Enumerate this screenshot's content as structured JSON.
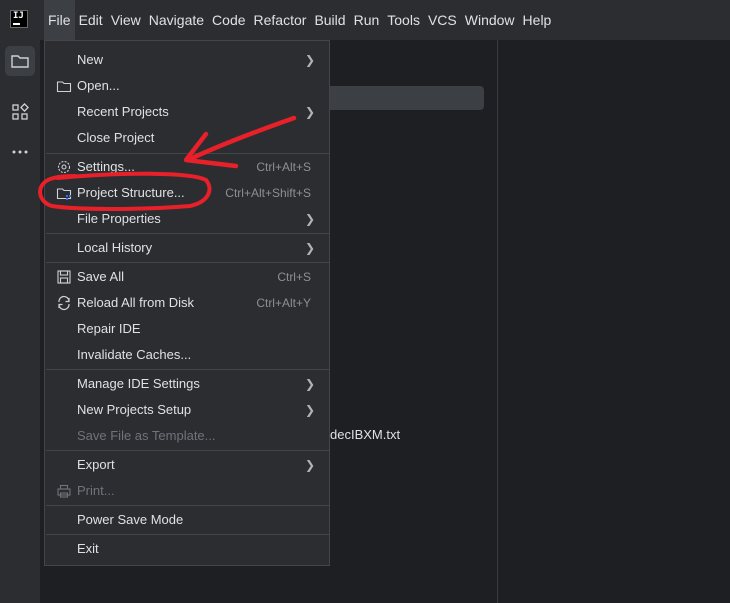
{
  "app": {
    "logo_text": "IJ"
  },
  "menubar": {
    "items": [
      {
        "label": "File"
      },
      {
        "label": "Edit"
      },
      {
        "label": "View"
      },
      {
        "label": "Navigate"
      },
      {
        "label": "Code"
      },
      {
        "label": "Refactor"
      },
      {
        "label": "Build"
      },
      {
        "label": "Run"
      },
      {
        "label": "Tools"
      },
      {
        "label": "VCS"
      },
      {
        "label": "Window"
      },
      {
        "label": "Help"
      }
    ]
  },
  "background": {
    "file_name_fragment": "decIBXM.txt"
  },
  "file_menu": {
    "new": "New",
    "open": "Open...",
    "recent_projects": "Recent Projects",
    "close_project": "Close Project",
    "settings": "Settings...",
    "settings_shortcut": "Ctrl+Alt+S",
    "project_structure": "Project Structure...",
    "project_structure_shortcut": "Ctrl+Alt+Shift+S",
    "file_properties": "File Properties",
    "local_history": "Local History",
    "save_all": "Save All",
    "save_all_shortcut": "Ctrl+S",
    "reload": "Reload All from Disk",
    "reload_shortcut": "Ctrl+Alt+Y",
    "repair_ide": "Repair IDE",
    "invalidate_caches": "Invalidate Caches...",
    "manage_ide_settings": "Manage IDE Settings",
    "new_projects_setup": "New Projects Setup",
    "save_as_template": "Save File as Template...",
    "export": "Export",
    "print": "Print...",
    "power_save": "Power Save Mode",
    "exit": "Exit"
  },
  "colors": {
    "annotation": "#e8202a",
    "menu_bg": "#2b2d30",
    "accent": "#3574f0"
  },
  "icons": [
    "folder-icon",
    "structure-icon",
    "more-icon",
    "gear-icon",
    "save-icon",
    "reload-icon",
    "print-icon"
  ]
}
